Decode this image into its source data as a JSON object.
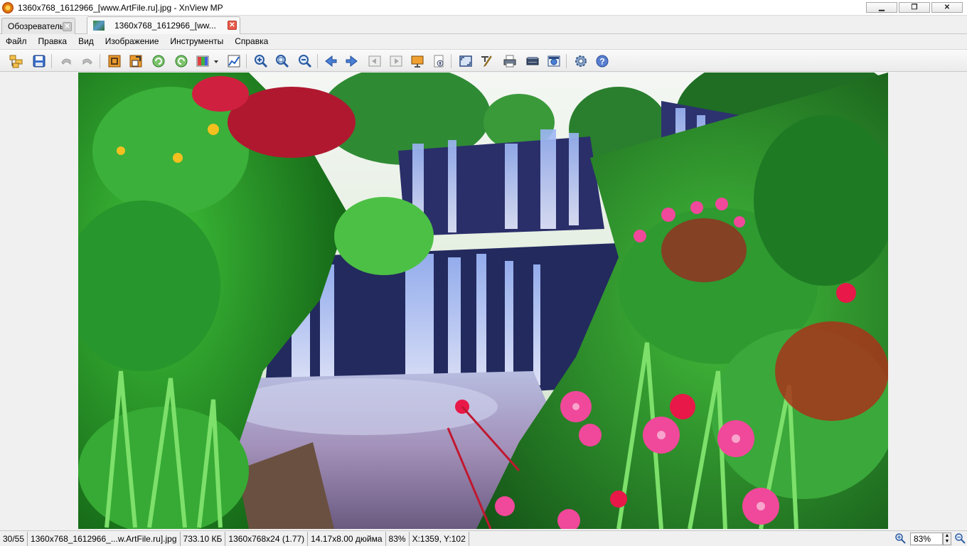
{
  "window": {
    "title": "1360x768_1612966_[www.ArtFile.ru].jpg - XnView MP",
    "minimize_label": "▁",
    "restore_label": "❐",
    "close_label": "✕"
  },
  "tabs": [
    {
      "label": "Обозреватель",
      "close": "✕"
    },
    {
      "label": "1360x768_1612966_[ww...",
      "close": "✕"
    }
  ],
  "menu": [
    "Файл",
    "Правка",
    "Вид",
    "Изображение",
    "Инструменты",
    "Справка"
  ],
  "toolbar": {
    "icons": [
      "browser-folders-icon",
      "save-icon",
      "undo-icon",
      "redo-icon",
      "crop-icon",
      "resize-icon",
      "rotate-left-icon",
      "rotate-right-icon",
      "adjust-colors-icon",
      "levels-icon",
      "zoom-in-icon",
      "zoom-fit-icon",
      "zoom-out-icon",
      "previous-icon",
      "next-icon",
      "first-icon",
      "last-icon",
      "slideshow-icon",
      "properties-icon",
      "fullscreen-icon",
      "edit-icon",
      "print-icon",
      "scanner-icon",
      "capture-icon",
      "settings-icon",
      "help-icon"
    ]
  },
  "status": {
    "position": "30/55",
    "filename": "1360x768_1612966_...w.ArtFile.ru].jpg",
    "filesize": "733.10 КБ",
    "dimensions": "1360x768x24 (1.77)",
    "print_size": "14.17x8.00 дюйма",
    "zoom_percent": "83%",
    "cursor": "X:1359, Y:102",
    "zoom_value": "83%",
    "spin_up": "▲",
    "spin_down": "▼"
  },
  "colors": {
    "title_bg": "#ffffff",
    "chrome_bg": "#f0f0f0",
    "accent_close_tab": "#e85a4a"
  }
}
